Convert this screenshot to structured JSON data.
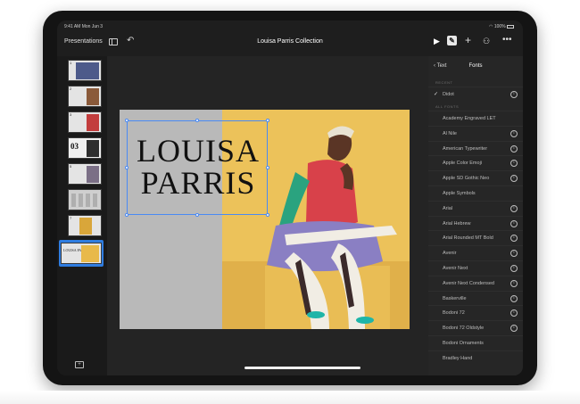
{
  "status_bar": {
    "time": "9:41 AM  Mon Jun 3",
    "battery": "100%"
  },
  "toolbar": {
    "presentations_label": "Presentations",
    "title": "Louisa Parris Collection"
  },
  "navigator": {
    "slides": [
      {
        "number": "1"
      },
      {
        "number": "2"
      },
      {
        "number": "3"
      },
      {
        "number": "4",
        "big": "03"
      },
      {
        "number": "5"
      },
      {
        "number": "6"
      },
      {
        "number": "7"
      },
      {
        "number": "8",
        "words": "LOUISA PARRIS"
      }
    ],
    "selected_index": 7
  },
  "slide": {
    "title_line1": "LOUISA",
    "title_line2": "PARRIS"
  },
  "font_panel": {
    "back_label": "Text",
    "title": "Fonts",
    "recent_label": "RECENT",
    "all_fonts_label": "ALL FONTS",
    "recent_font": "Didot",
    "fonts": [
      "Academy Engraved LET",
      "Al Nile",
      "American Typewriter",
      "Apple  Color  Emoji",
      "Apple SD Gothic Neo",
      "Apple Symbols",
      "Arial",
      "Arial Hebrew",
      "Arial Rounded MT Bold",
      "Avenir",
      "Avenir Next",
      "Avenir Next Condensed",
      "Baskerville",
      "Bodoni 72",
      "Bodoni 72 Oldstyle",
      "Bodoni Ornaments",
      "Bradley Hand"
    ],
    "fonts_with_info": [
      "Al Nile",
      "American Typewriter",
      "Apple  Color  Emoji",
      "Apple SD Gothic Neo",
      "Arial",
      "Arial Hebrew",
      "Arial Rounded MT Bold",
      "Avenir",
      "Avenir Next",
      "Avenir Next Condensed",
      "Baskerville",
      "Bodoni 72",
      "Bodoni 72 Oldstyle"
    ]
  },
  "colors": {
    "accent": "#4a8af4",
    "selected_thumb": "#2f7de1",
    "photo_background": "#ecc25a",
    "slide_left": "#b9b9b9"
  }
}
